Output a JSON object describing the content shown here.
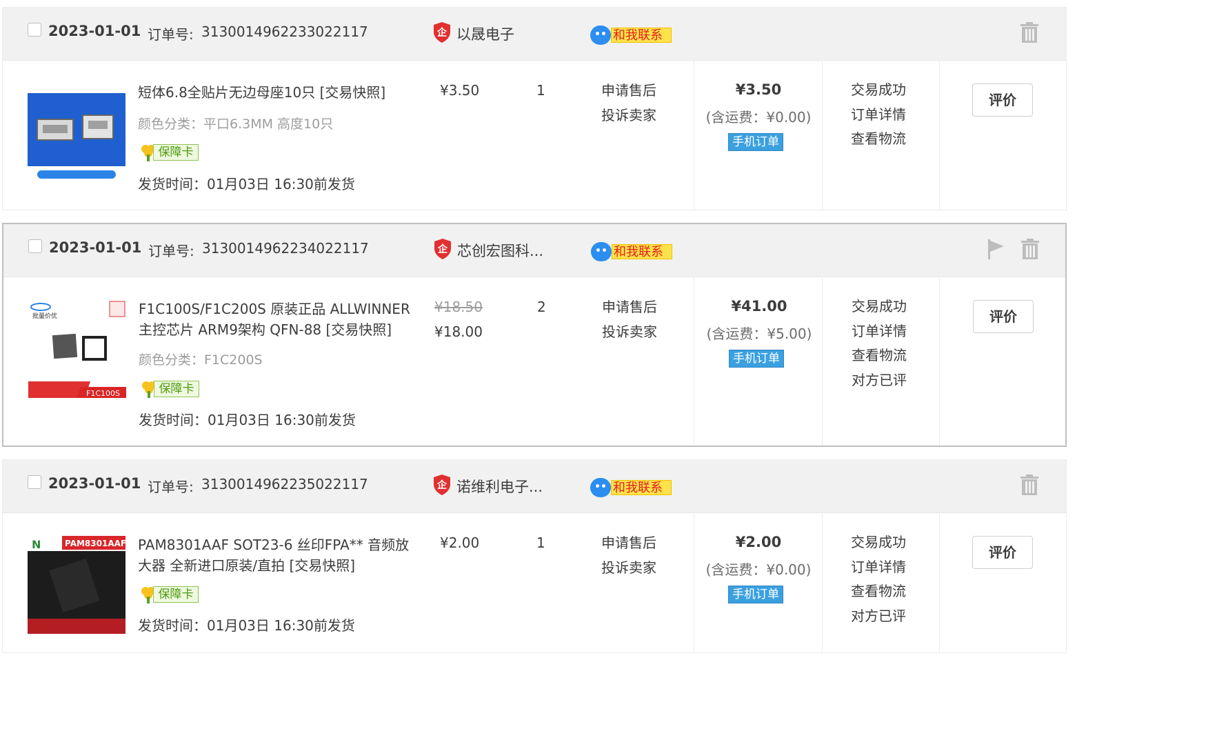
{
  "orders": [
    {
      "date": "2023-01-01",
      "order_no_label": "订单号:",
      "order_no": "3130014962233022117",
      "shop": "以晟电子",
      "contact_label": "和我联系",
      "item": {
        "title": "短体6.8全贴片无边母座10只 [交易快照]",
        "variant": "颜色分类：平口6.3MM 高度10只",
        "guarantee": "保障卡",
        "ship_time": "发货时间：01月03日 16:30前发货",
        "price": "¥3.50",
        "qty": "1",
        "after_sale": "申请售后",
        "complain": "投诉卖家",
        "total": "¥3.50",
        "shipping_fee": "(含运费：¥0.00)",
        "mobile_order": "手机订单",
        "status": [
          "交易成功",
          "订单详情",
          "查看物流"
        ],
        "rate": "评价"
      }
    },
    {
      "date": "2023-01-01",
      "order_no_label": "订单号:",
      "order_no": "3130014962234022117",
      "shop": "芯创宏图科...",
      "contact_label": "和我联系",
      "item": {
        "title": "F1C100S/F1C200S 原装正品 ALLWINNER 主控芯片 ARM9架构 QFN-88 [交易快照]",
        "variant": "颜色分类：F1C200S",
        "guarantee": "保障卡",
        "ship_time": "发货时间：01月03日 16:30前发货",
        "original_price": "¥18.50",
        "price": "¥18.00",
        "qty": "2",
        "after_sale": "申请售后",
        "complain": "投诉卖家",
        "total": "¥41.00",
        "shipping_fee": "(含运费：¥5.00)",
        "mobile_order": "手机订单",
        "status": [
          "交易成功",
          "订单详情",
          "查看物流",
          "对方已评"
        ],
        "rate": "评价"
      }
    },
    {
      "date": "2023-01-01",
      "order_no_label": "订单号:",
      "order_no": "3130014962235022117",
      "shop": "诺维利电子...",
      "contact_label": "和我联系",
      "item": {
        "title": "PAM8301AAF SOT23-6 丝印FPA** 音频放大器 全新进口原装/直拍 [交易快照]",
        "guarantee": "保障卡",
        "ship_time": "发货时间：01月03日 16:30前发货",
        "price": "¥2.00",
        "qty": "1",
        "after_sale": "申请售后",
        "complain": "投诉卖家",
        "total": "¥2.00",
        "shipping_fee": "(含运费：¥0.00)",
        "mobile_order": "手机订单",
        "status": [
          "交易成功",
          "订单详情",
          "查看物流",
          "对方已评"
        ],
        "rate": "评价"
      }
    }
  ],
  "thumb_text": {
    "thumb2_brand": "批量价优",
    "thumb2_tag": "F1C100S",
    "thumb3_label": "PAM8301AAF"
  },
  "icons": {
    "shop": "enterprise-shield-icon",
    "contact": "chat-bubble-icon",
    "trash": "trash-icon",
    "flag": "flag-icon",
    "guarantee": "guarantee-flower-icon"
  },
  "colors": {
    "header_bg": "#f1f1f1",
    "shop_badge": "#e03030",
    "contact_label_bg": "#ffe24a",
    "contact_label_text": "#e02020",
    "mobile_order_bg": "#3aa0e0",
    "guarantee_text": "#4f9a10"
  }
}
